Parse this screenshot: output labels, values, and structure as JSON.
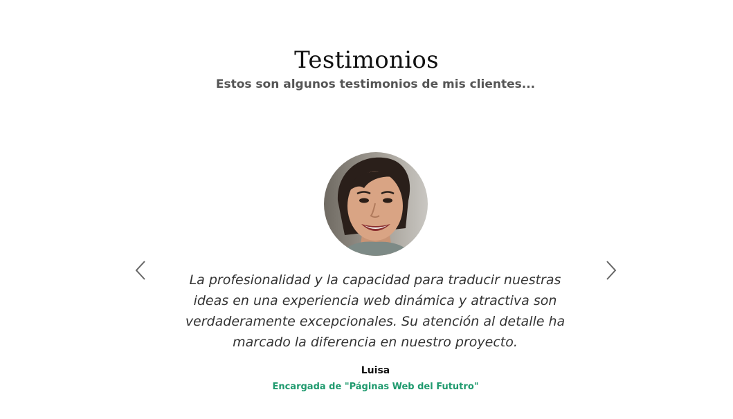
{
  "section": {
    "title": "Testimonios",
    "subtitle": "Estos son algunos testimonios de mis clientes..."
  },
  "testimonial": {
    "quote": "La profesionalidad y la capacidad para traducir nuestras ideas en una experiencia web dinámica y atractiva son verdaderamente excepcionales. Su atención al detalle ha marcado la diferencia en nuestro proyecto.",
    "name": "Luisa",
    "role": "Encargada de \"Páginas Web del Fututro\"",
    "accent_color": "#1f9a6e"
  },
  "controls": {
    "prev_icon": "chevron-left-icon",
    "next_icon": "chevron-right-icon"
  }
}
